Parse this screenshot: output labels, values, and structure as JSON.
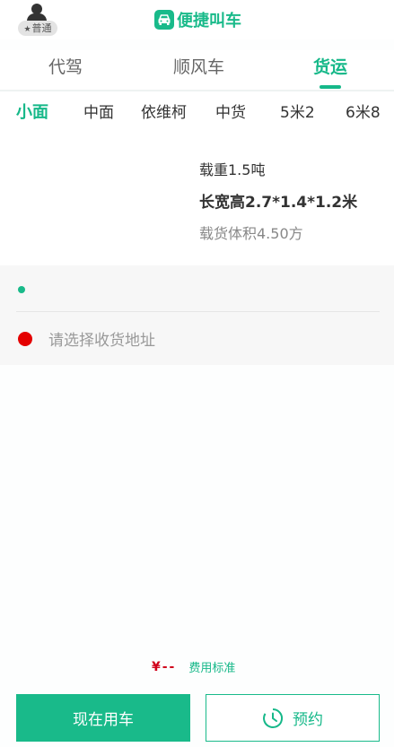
{
  "header": {
    "user_badge": "普通",
    "app_title": "便捷叫车",
    "brand_color": "#19ba8a"
  },
  "service_tabs": [
    {
      "label": "代驾",
      "active": false
    },
    {
      "label": "顺风车",
      "active": false
    },
    {
      "label": "货运",
      "active": true
    }
  ],
  "vehicle_types": [
    {
      "label": "小面",
      "active": true
    },
    {
      "label": "中面",
      "active": false
    },
    {
      "label": "依维柯",
      "active": false
    },
    {
      "label": "中货",
      "active": false
    },
    {
      "label": "5米2",
      "active": false
    },
    {
      "label": "6米8",
      "active": false
    }
  ],
  "vehicle_spec": {
    "load": "载重1.5吨",
    "dimensions": "长宽高2.7*1.4*1.2米",
    "volume": "载货体积4.50方"
  },
  "address": {
    "pickup_value": "",
    "dropoff_placeholder": "请选择收货地址"
  },
  "fee": {
    "amount": "¥--",
    "standard_link": "费用标准",
    "amount_color": "#d0021b"
  },
  "actions": {
    "now_label": "现在用车",
    "book_label": "预约"
  }
}
